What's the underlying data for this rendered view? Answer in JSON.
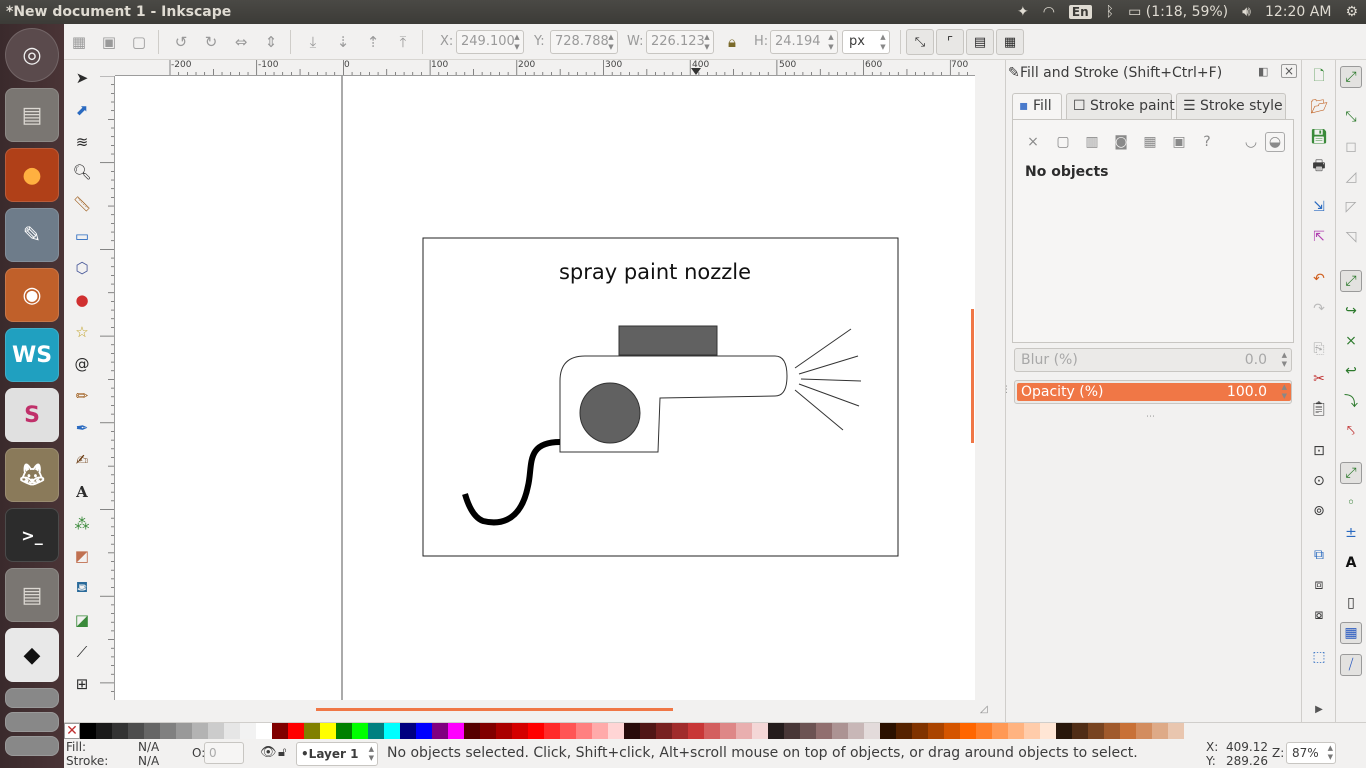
{
  "window": {
    "title": "*New document 1 - Inkscape"
  },
  "system_tray": {
    "language": "En",
    "battery": "(1:18, 59%)",
    "clock": "12:20 AM"
  },
  "launcher": {
    "apps": [
      "ubuntu-dash",
      "files",
      "firefox",
      "text-editor",
      "blender",
      "webstorm",
      "slack",
      "gimp",
      "terminal",
      "files-2",
      "inkscape",
      "workspace-1",
      "workspace-2",
      "workspace-3"
    ]
  },
  "toolbar": {
    "x_label": "X:",
    "x_value": "249.100",
    "y_label": "Y:",
    "y_value": "728.788",
    "w_label": "W:",
    "w_value": "226.123",
    "h_label": "H:",
    "h_value": "24.194",
    "unit": "px"
  },
  "ruler": {
    "top_labels": [
      "-200",
      "-100",
      "0",
      "100",
      "200",
      "300",
      "400",
      "500",
      "600",
      "700"
    ]
  },
  "canvas": {
    "drawing_title": "spray paint nozzle"
  },
  "dock": {
    "title": "Fill and Stroke (Shift+Ctrl+F)",
    "tabs": [
      "Fill",
      "Stroke paint",
      "Stroke style"
    ],
    "no_objects": "No objects",
    "blur_label": "Blur (%)",
    "blur_value": "0.0",
    "opacity_label": "Opacity (%)",
    "opacity_value": "100.0"
  },
  "status": {
    "fill_label": "Fill:",
    "fill_value": "N/A",
    "stroke_label": "Stroke:",
    "stroke_value": "N/A",
    "opacity_label": "O:",
    "opacity_value": "0",
    "layer": "•Layer 1",
    "message": "No objects selected. Click, Shift+click, Alt+scroll mouse on top of objects, or drag around objects to select.",
    "cursor_x_label": "X:",
    "cursor_x": "409.12",
    "cursor_y_label": "Y:",
    "cursor_y": "289.26",
    "zoom_label": "Z:",
    "zoom": "87%"
  },
  "colors": {
    "accent": "#f07746",
    "palette": [
      "#000000",
      "#1a1a1a",
      "#333333",
      "#4d4d4d",
      "#666666",
      "#808080",
      "#999999",
      "#b3b3b3",
      "#cccccc",
      "#e6e6e6",
      "#f2f2f2",
      "#ffffff",
      "#800000",
      "#ff0000",
      "#808000",
      "#ffff00",
      "#008000",
      "#00ff00",
      "#008080",
      "#00ffff",
      "#000080",
      "#0000ff",
      "#800080",
      "#ff00ff",
      "#550000",
      "#800000",
      "#aa0000",
      "#d40000",
      "#ff0000",
      "#ff2a2a",
      "#ff5555",
      "#ff8080",
      "#ffaaaa",
      "#ffd5d5",
      "#280b0b",
      "#501616",
      "#782121",
      "#a02c2c",
      "#c83737",
      "#d35f5f",
      "#de8787",
      "#e9afaf",
      "#f4d7d7",
      "#241c1c",
      "#483737",
      "#6c5353",
      "#916f6f",
      "#ac9393",
      "#c8b7b7",
      "#e3dbdb",
      "#2b1100",
      "#552200",
      "#803300",
      "#aa4400",
      "#d45500",
      "#ff6600",
      "#ff7f2a",
      "#ff9955",
      "#ffb380",
      "#ffccaa",
      "#ffe6d5",
      "#28170b",
      "#502d16",
      "#784421",
      "#a05a2c",
      "#c87137",
      "#d38d5f",
      "#deaa87",
      "#e9c6af"
    ]
  }
}
